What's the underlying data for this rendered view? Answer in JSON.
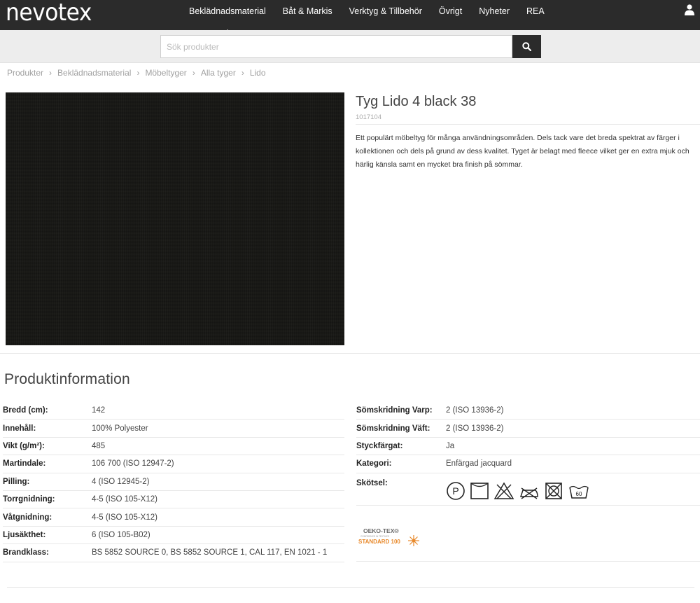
{
  "header": {
    "logo": "nevotex",
    "nav": [
      {
        "label": "Beklädnadsmaterial",
        "active": true
      },
      {
        "label": "Båt & Markis",
        "active": false
      },
      {
        "label": "Verktyg & Tillbehör",
        "active": false
      },
      {
        "label": "Övrigt",
        "active": false
      },
      {
        "label": "Nyheter",
        "active": false
      },
      {
        "label": "REA",
        "active": false
      }
    ],
    "user_icon": "user-icon"
  },
  "search": {
    "placeholder": "Sök produkter",
    "button_icon": "search-icon"
  },
  "breadcrumb": [
    "Produkter",
    "Beklädnadsmaterial",
    "Möbeltyger",
    "Alla tyger",
    "Lido"
  ],
  "product": {
    "title": "Tyg Lido 4 black 38",
    "article_no": "1017104",
    "description": "Ett populärt möbeltyg för många användningsområden. Dels tack vare det breda spektrat av färger i kollektionen och dels på grund av dess kvalitet. Tyget är belagt med fleece vilket ger en extra mjuk och härlig känsla samt en mycket bra finish på sömmar.",
    "image_color": "#1a1a17"
  },
  "info": {
    "title": "Produktinformation",
    "left": [
      {
        "label": "Bredd (cm):",
        "value": "142"
      },
      {
        "label": "Innehåll:",
        "value": "100% Polyester"
      },
      {
        "label": "Vikt (g/m²):",
        "value": "485"
      },
      {
        "label": "Martindale:",
        "value": "106 700 (ISO 12947-2)"
      },
      {
        "label": "Pilling:",
        "value": "4 (ISO 12945-2)"
      },
      {
        "label": "Torrgnidning:",
        "value": "4-5 (ISO 105-X12)"
      },
      {
        "label": "Våtgnidning:",
        "value": "4-5 (ISO 105-X12)"
      },
      {
        "label": "Ljusäkthet:",
        "value": "6 (ISO 105-B02)"
      },
      {
        "label": "Brandklass:",
        "value": "BS 5852 SOURCE 0, BS 5852 SOURCE 1, CAL 117, EN 1021 - 1"
      }
    ],
    "right": [
      {
        "label": "Sömskridning Varp:",
        "value": "2 (ISO 13936-2)"
      },
      {
        "label": "Sömskridning Väft:",
        "value": "2 (ISO 13936-2)"
      },
      {
        "label": "Styckfärgat:",
        "value": "Ja"
      },
      {
        "label": "Kategori:",
        "value": "Enfärgad jacquard"
      }
    ],
    "care_label": "Skötsel:",
    "care_icons": [
      "dry-clean-p-icon",
      "no-tumble-dry-icon",
      "no-bleach-icon",
      "no-iron-icon",
      "no-tumble-dryer-icon",
      "wash-60-icon"
    ],
    "wash_temp": "60",
    "oeko": {
      "line1": "OEKO-TEX®",
      "line2": "CONFIDENCE IN TEXTILES",
      "line3": "STANDARD 100"
    }
  },
  "colors": {
    "topbar": "#2b2b2b",
    "search_band": "#ededed",
    "oeko_orange": "#e8892b"
  }
}
